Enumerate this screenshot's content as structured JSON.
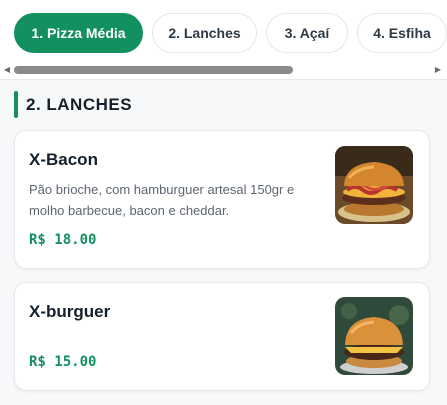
{
  "tabs": [
    {
      "label": "1. Pizza Média",
      "active": true
    },
    {
      "label": "2. Lanches",
      "active": false
    },
    {
      "label": "3. Açaí",
      "active": false
    },
    {
      "label": "4. Esfiha",
      "active": false
    }
  ],
  "section": {
    "title": "2. LANCHES"
  },
  "items": [
    {
      "name": "X-Bacon",
      "description": "Pão brioche, com hamburguer artesal 150gr e molho barbecue, bacon e cheddar.",
      "price": "R$ 18.00",
      "image_icon": "burger-bacon-photo"
    },
    {
      "name": "X-burguer",
      "description": "",
      "price": "R$ 15.00",
      "image_icon": "burger-photo"
    }
  ],
  "colors": {
    "accent": "#12905f",
    "text": "#15202b",
    "muted": "#5d6670"
  }
}
